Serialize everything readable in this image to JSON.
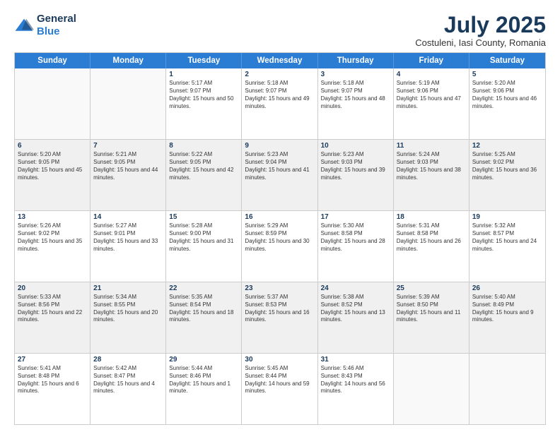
{
  "logo": {
    "general": "General",
    "blue": "Blue"
  },
  "title": {
    "main": "July 2025",
    "sub": "Costuleni, Iasi County, Romania"
  },
  "header": {
    "days": [
      "Sunday",
      "Monday",
      "Tuesday",
      "Wednesday",
      "Thursday",
      "Friday",
      "Saturday"
    ]
  },
  "rows": [
    [
      {
        "day": "",
        "info": ""
      },
      {
        "day": "",
        "info": ""
      },
      {
        "day": "1",
        "info": "Sunrise: 5:17 AM\nSunset: 9:07 PM\nDaylight: 15 hours and 50 minutes."
      },
      {
        "day": "2",
        "info": "Sunrise: 5:18 AM\nSunset: 9:07 PM\nDaylight: 15 hours and 49 minutes."
      },
      {
        "day": "3",
        "info": "Sunrise: 5:18 AM\nSunset: 9:07 PM\nDaylight: 15 hours and 48 minutes."
      },
      {
        "day": "4",
        "info": "Sunrise: 5:19 AM\nSunset: 9:06 PM\nDaylight: 15 hours and 47 minutes."
      },
      {
        "day": "5",
        "info": "Sunrise: 5:20 AM\nSunset: 9:06 PM\nDaylight: 15 hours and 46 minutes."
      }
    ],
    [
      {
        "day": "6",
        "info": "Sunrise: 5:20 AM\nSunset: 9:05 PM\nDaylight: 15 hours and 45 minutes."
      },
      {
        "day": "7",
        "info": "Sunrise: 5:21 AM\nSunset: 9:05 PM\nDaylight: 15 hours and 44 minutes."
      },
      {
        "day": "8",
        "info": "Sunrise: 5:22 AM\nSunset: 9:05 PM\nDaylight: 15 hours and 42 minutes."
      },
      {
        "day": "9",
        "info": "Sunrise: 5:23 AM\nSunset: 9:04 PM\nDaylight: 15 hours and 41 minutes."
      },
      {
        "day": "10",
        "info": "Sunrise: 5:23 AM\nSunset: 9:03 PM\nDaylight: 15 hours and 39 minutes."
      },
      {
        "day": "11",
        "info": "Sunrise: 5:24 AM\nSunset: 9:03 PM\nDaylight: 15 hours and 38 minutes."
      },
      {
        "day": "12",
        "info": "Sunrise: 5:25 AM\nSunset: 9:02 PM\nDaylight: 15 hours and 36 minutes."
      }
    ],
    [
      {
        "day": "13",
        "info": "Sunrise: 5:26 AM\nSunset: 9:02 PM\nDaylight: 15 hours and 35 minutes."
      },
      {
        "day": "14",
        "info": "Sunrise: 5:27 AM\nSunset: 9:01 PM\nDaylight: 15 hours and 33 minutes."
      },
      {
        "day": "15",
        "info": "Sunrise: 5:28 AM\nSunset: 9:00 PM\nDaylight: 15 hours and 31 minutes."
      },
      {
        "day": "16",
        "info": "Sunrise: 5:29 AM\nSunset: 8:59 PM\nDaylight: 15 hours and 30 minutes."
      },
      {
        "day": "17",
        "info": "Sunrise: 5:30 AM\nSunset: 8:58 PM\nDaylight: 15 hours and 28 minutes."
      },
      {
        "day": "18",
        "info": "Sunrise: 5:31 AM\nSunset: 8:58 PM\nDaylight: 15 hours and 26 minutes."
      },
      {
        "day": "19",
        "info": "Sunrise: 5:32 AM\nSunset: 8:57 PM\nDaylight: 15 hours and 24 minutes."
      }
    ],
    [
      {
        "day": "20",
        "info": "Sunrise: 5:33 AM\nSunset: 8:56 PM\nDaylight: 15 hours and 22 minutes."
      },
      {
        "day": "21",
        "info": "Sunrise: 5:34 AM\nSunset: 8:55 PM\nDaylight: 15 hours and 20 minutes."
      },
      {
        "day": "22",
        "info": "Sunrise: 5:35 AM\nSunset: 8:54 PM\nDaylight: 15 hours and 18 minutes."
      },
      {
        "day": "23",
        "info": "Sunrise: 5:37 AM\nSunset: 8:53 PM\nDaylight: 15 hours and 16 minutes."
      },
      {
        "day": "24",
        "info": "Sunrise: 5:38 AM\nSunset: 8:52 PM\nDaylight: 15 hours and 13 minutes."
      },
      {
        "day": "25",
        "info": "Sunrise: 5:39 AM\nSunset: 8:50 PM\nDaylight: 15 hours and 11 minutes."
      },
      {
        "day": "26",
        "info": "Sunrise: 5:40 AM\nSunset: 8:49 PM\nDaylight: 15 hours and 9 minutes."
      }
    ],
    [
      {
        "day": "27",
        "info": "Sunrise: 5:41 AM\nSunset: 8:48 PM\nDaylight: 15 hours and 6 minutes."
      },
      {
        "day": "28",
        "info": "Sunrise: 5:42 AM\nSunset: 8:47 PM\nDaylight: 15 hours and 4 minutes."
      },
      {
        "day": "29",
        "info": "Sunrise: 5:44 AM\nSunset: 8:46 PM\nDaylight: 15 hours and 1 minute."
      },
      {
        "day": "30",
        "info": "Sunrise: 5:45 AM\nSunset: 8:44 PM\nDaylight: 14 hours and 59 minutes."
      },
      {
        "day": "31",
        "info": "Sunrise: 5:46 AM\nSunset: 8:43 PM\nDaylight: 14 hours and 56 minutes."
      },
      {
        "day": "",
        "info": ""
      },
      {
        "day": "",
        "info": ""
      }
    ]
  ]
}
